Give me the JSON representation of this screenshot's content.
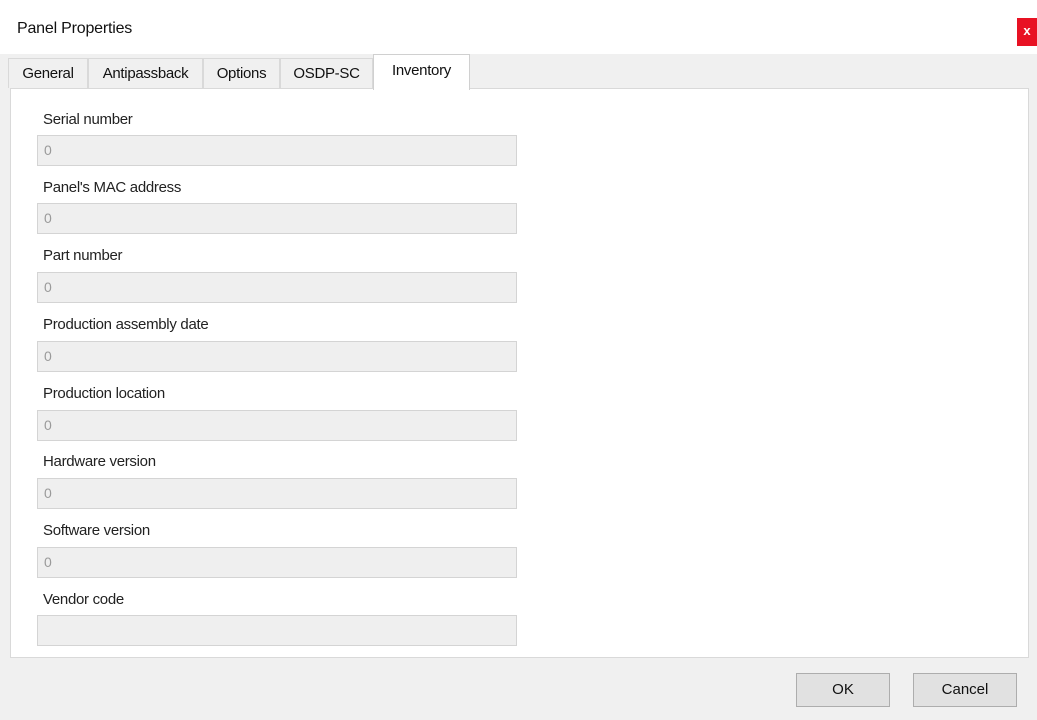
{
  "window": {
    "title": "Panel Properties",
    "close_label": "x",
    "colors": {
      "close": "#e81123",
      "field_bg": "#efefef",
      "panel_bg": "#ffffff",
      "dialog_bg": "#f0f0f0"
    }
  },
  "tabs": [
    {
      "label": "General"
    },
    {
      "label": "Antipassback"
    },
    {
      "label": "Options"
    },
    {
      "label": "OSDP-SC"
    },
    {
      "label": "Inventory",
      "selected": true
    }
  ],
  "fields": [
    {
      "label": "Serial number",
      "value": "0"
    },
    {
      "label": "Panel's MAC address",
      "value": "0"
    },
    {
      "label": "Part number",
      "value": "0"
    },
    {
      "label": "Production assembly date",
      "value": "0"
    },
    {
      "label": "Production location",
      "value": "0"
    },
    {
      "label": "Hardware version",
      "value": "0"
    },
    {
      "label": "Software version",
      "value": "0"
    },
    {
      "label": "Vendor code",
      "value": ""
    }
  ],
  "buttons": {
    "ok": "OK",
    "cancel": "Cancel"
  }
}
